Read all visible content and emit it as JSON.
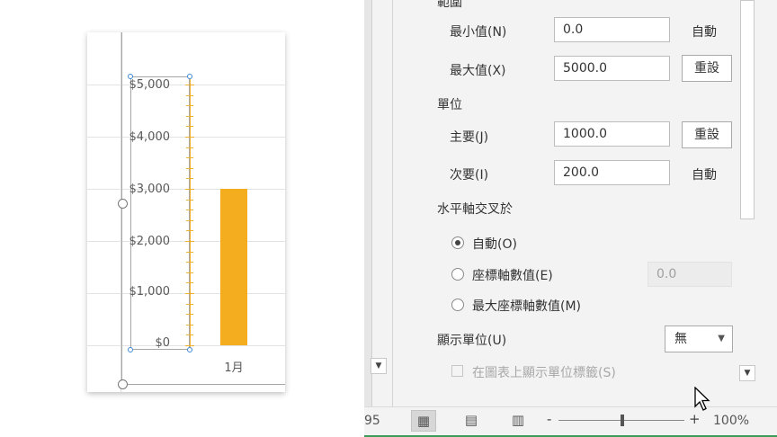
{
  "chart": {
    "y_ticks": [
      "$5,000",
      "$4,000",
      "$3,000",
      "$2,000",
      "$1,000",
      "$0"
    ],
    "category": "1月",
    "bar_color": "#f4ad1f",
    "axis_color": "#f0b030"
  },
  "chart_data": {
    "type": "bar",
    "categories": [
      "1月"
    ],
    "values": [
      3000
    ],
    "ylim": [
      0,
      5000
    ],
    "y_major_unit": 1000,
    "y_minor_unit": 200,
    "title": "",
    "xlabel": "",
    "ylabel": "",
    "grid": true
  },
  "panel": {
    "section_bounds": "範圍",
    "min_label": "最小值(N)",
    "min_value": "0.0",
    "min_state": "自動",
    "max_label": "最大值(X)",
    "max_value": "5000.0",
    "max_reset": "重設",
    "section_units": "單位",
    "major_label": "主要(J)",
    "major_value": "1000.0",
    "major_reset": "重設",
    "minor_label": "次要(I)",
    "minor_value": "200.0",
    "minor_state": "自動",
    "crosses_title": "水平軸交叉於",
    "opt_auto": "自動(O)",
    "opt_axis_value": "座標軸數值(E)",
    "axis_value_field": "0.0",
    "opt_max_axis_value": "最大座標軸數值(M)",
    "display_units_label": "顯示單位(U)",
    "display_units_value": "無",
    "show_units_label": "在圖表上顯示單位標籤(S)"
  },
  "statusbar": {
    "left_text": "95",
    "zoom_minus": "-",
    "zoom_plus": "+",
    "zoom_level": "100%"
  }
}
